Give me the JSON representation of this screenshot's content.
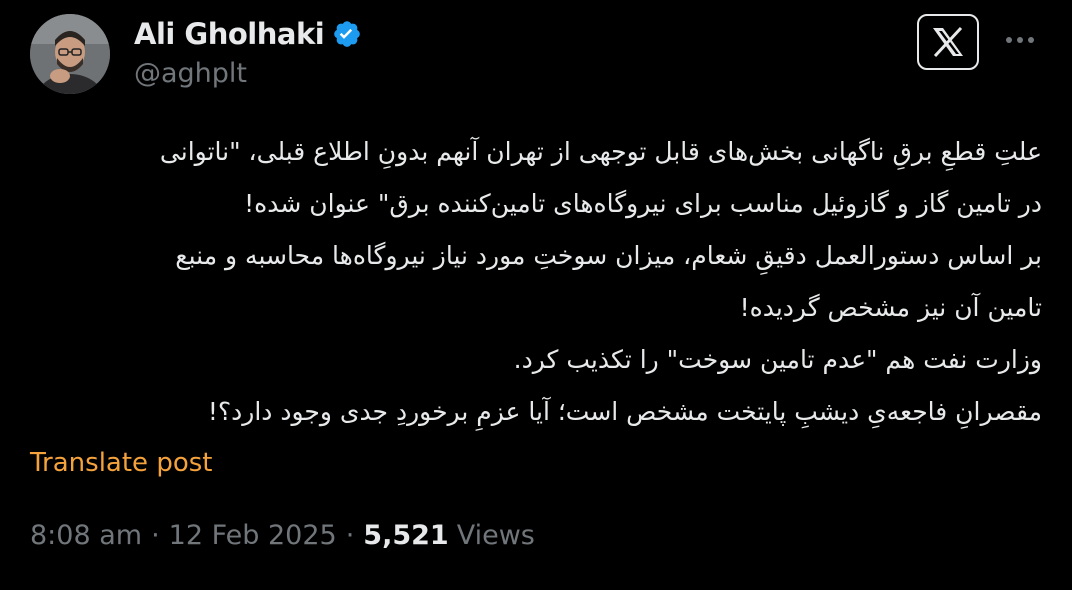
{
  "author": {
    "display_name": "Ali Gholhaki",
    "handle": "@aghplt",
    "verified": true,
    "verified_color": "#1d9bf0"
  },
  "header": {
    "logo_icon": "x-logo-icon",
    "more_icon": "more-horizontal-icon"
  },
  "tweet": {
    "lines": [
      "علتِ قطعِ برقِ ناگهانی بخش‌های قابل توجهی از تهران آنهم بدونِ اطلاع قبلی، \"ناتوانی",
      "در تامین گاز و گازوئیل مناسب برای نیروگاه‌های تامین‌کننده برق\" عنوان شده!",
      "بر اساس دستورالعمل دقیقِ شعام، میزان سوختِ مورد نیاز نیروگاه‌ها محاسبه و منبع",
      "تامین آن نیز مشخص گردیده!",
      "وزارت نفت هم \"عدم تامین سوخت\" را تکذیب کرد.",
      "مقصرانِ فاجعه‌یِ دیشبِ پایتخت مشخص است؛ آیا عزمِ برخوردِ جدی وجود دارد؟!"
    ],
    "translate_label": "Translate post",
    "translate_color": "#f4a23c"
  },
  "meta": {
    "time": "8:08 am",
    "separator": "·",
    "date": "12 Feb 2025",
    "views_count": "5,521",
    "views_label": "Views"
  },
  "colors": {
    "background": "#000000",
    "text": "#e7e9ea",
    "muted": "#71767b"
  }
}
